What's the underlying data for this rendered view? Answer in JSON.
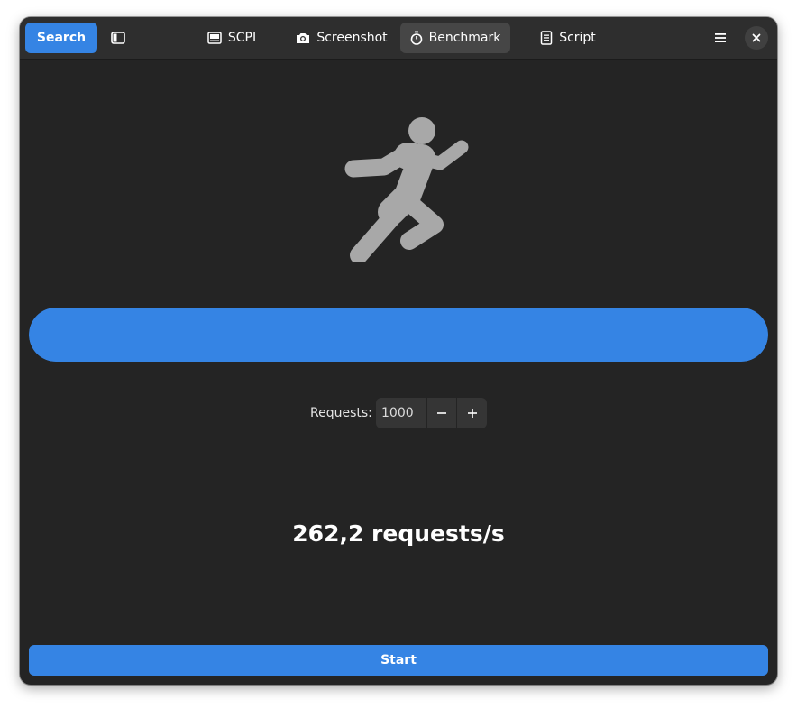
{
  "header": {
    "search_label": "Search",
    "tabs": [
      {
        "label": "SCPI",
        "icon": "terminal-icon",
        "active": false
      },
      {
        "label": "Screenshot",
        "icon": "camera-icon",
        "active": false
      },
      {
        "label": "Benchmark",
        "icon": "stopwatch-icon",
        "active": true
      },
      {
        "label": "Script",
        "icon": "document-icon",
        "active": false
      }
    ]
  },
  "benchmark": {
    "progress": 1.0,
    "requests_label": "Requests:",
    "requests_value": "1000",
    "rate_text": "262,2 requests/s",
    "start_label": "Start"
  },
  "colors": {
    "accent": "#3584e4",
    "window_bg": "#242424",
    "header_bg": "#2e2e2e",
    "icon_gray": "#a8a8a8"
  }
}
